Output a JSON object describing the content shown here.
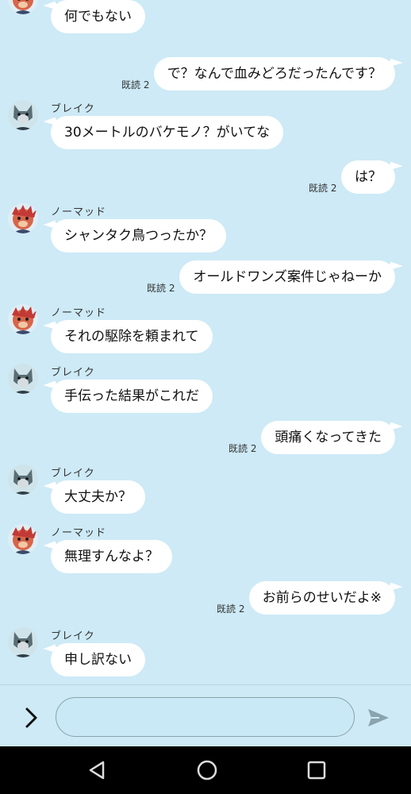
{
  "colors": {
    "background": "#cdeaf6",
    "bubble": "#ffffff",
    "navbar": "#000000"
  },
  "users": {
    "nomad": "ノーマッド",
    "blake": "ブレイク"
  },
  "messages": [
    {
      "side": "in",
      "sender": "ノーマッド",
      "avatar": "nomad",
      "text": "何でもない"
    },
    {
      "side": "out",
      "text": "で？なんで血みどろだったんです？",
      "read": "既読 2"
    },
    {
      "side": "in",
      "sender": "ブレイク",
      "avatar": "blake",
      "text": "30メートルのバケモノ？がいてな"
    },
    {
      "side": "out",
      "text": "は？",
      "read": "既読 2"
    },
    {
      "side": "in",
      "sender": "ノーマッド",
      "avatar": "nomad",
      "text": "シャンタク鳥つったか？"
    },
    {
      "side": "out",
      "text": "オールドワンズ案件じゃねーか",
      "read": "既読 2"
    },
    {
      "side": "in",
      "sender": "ノーマッド",
      "avatar": "nomad",
      "text": "それの駆除を頼まれて"
    },
    {
      "side": "in",
      "sender": "ブレイク",
      "avatar": "blake",
      "text": "手伝った結果がこれだ"
    },
    {
      "side": "out",
      "text": "頭痛くなってきた",
      "read": "既読 2"
    },
    {
      "side": "in",
      "sender": "ブレイク",
      "avatar": "blake",
      "text": "大丈夫か？"
    },
    {
      "side": "in",
      "sender": "ノーマッド",
      "avatar": "nomad",
      "text": "無理すんなよ？"
    },
    {
      "side": "out",
      "text": "お前らのせいだよ※",
      "read": "既読 2"
    },
    {
      "side": "in",
      "sender": "ブレイク",
      "avatar": "blake",
      "text": "申し訳ない"
    }
  ],
  "input": {
    "placeholder": "",
    "value": ""
  },
  "icons": {
    "expand": "chevron-right-icon",
    "send": "send-icon",
    "back": "back-triangle-icon",
    "home": "home-circle-icon",
    "recents": "recents-square-icon"
  }
}
